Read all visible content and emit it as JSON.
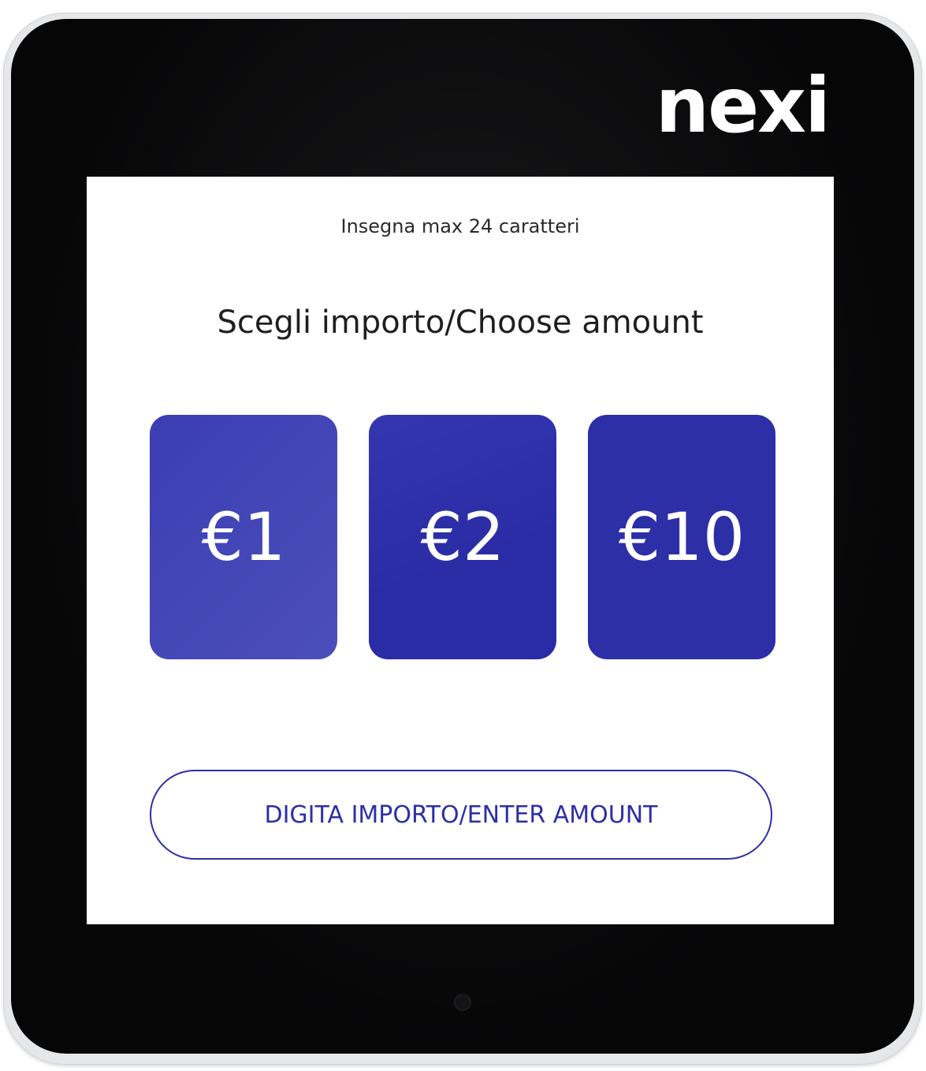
{
  "device": {
    "brand_logo": "nexi",
    "colors": {
      "bezel": "#0b0b0c",
      "frame": "#e6e7e9",
      "screen_bg": "#ffffff",
      "accent": "#2d2fa6"
    }
  },
  "screen": {
    "merchant_label": "Insegna max 24 caratteri",
    "headline": "Scegli importo/Choose amount",
    "amount_options": [
      {
        "label": "€1"
      },
      {
        "label": "€2"
      },
      {
        "label": "€10"
      }
    ],
    "enter_amount_label": "DIGITA IMPORTO/ENTER AMOUNT"
  }
}
